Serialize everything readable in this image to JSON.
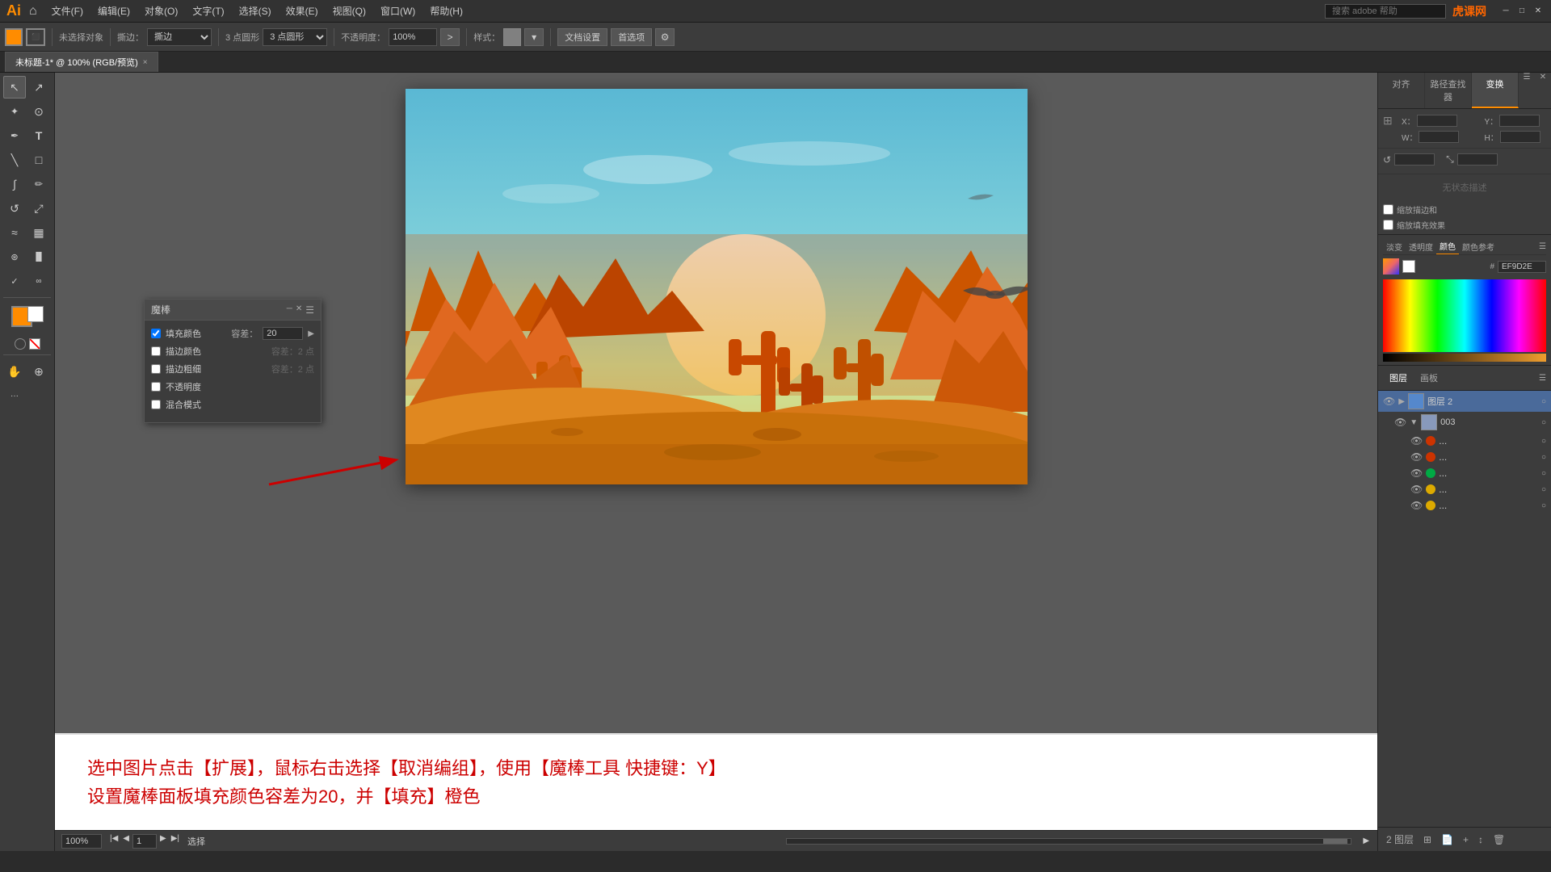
{
  "app": {
    "title": "Adobe Illustrator",
    "logo": "Ai"
  },
  "menu": {
    "items": [
      "文件(F)",
      "编辑(E)",
      "对象(O)",
      "文字(T)",
      "选择(S)",
      "效果(E)",
      "视图(Q)",
      "窗口(W)",
      "帮助(H)"
    ],
    "search_placeholder": "搜索 adobe 帮助",
    "logo_right": "虎课网",
    "window_controls": [
      "─",
      "□",
      "✕"
    ]
  },
  "toolbar": {
    "no_selection": "未选择对象",
    "stroke_label": "描边：",
    "blend_label": "撕边：",
    "blend_value": "撕边",
    "point_label": "3 点圆形",
    "opacity_label": "不透明度：",
    "opacity_value": "100%",
    "style_label": "样式：",
    "doc_settings": "文档设置",
    "prefs": "首选项"
  },
  "tab": {
    "title": "未标题-1* @ 100% (RGB/预览)",
    "close": "×"
  },
  "canvas": {
    "zoom": "100%",
    "page": "1",
    "tool_label": "选择"
  },
  "magic_wand": {
    "title": "魔棒",
    "fill_color": "填充颜色",
    "fill_color_checked": true,
    "tolerance_label": "容差：",
    "tolerance_value": "20",
    "stroke_color": "描边颜色",
    "stroke_color_checked": false,
    "stroke_width": "描边粗细",
    "stroke_width_checked": false,
    "opacity": "不透明度",
    "opacity_checked": false,
    "blend_mode": "混合模式",
    "blend_mode_checked": false,
    "stroke_tolerance": "容差：",
    "stroke_tolerance_value": "2 点",
    "stroke_width_tolerance": "容差：",
    "stroke_width_tolerance_value": "2 点"
  },
  "right_panel": {
    "tabs": [
      "对齐",
      "路径查找器",
      "变换"
    ],
    "active_tab": "变换",
    "transform": {
      "x_label": "X：",
      "y_label": "Y：",
      "w_label": "W：",
      "h_label": "H："
    },
    "no_status": "无状态描述"
  },
  "color_panel": {
    "tabs": [
      "淡变",
      "透明度",
      "颜色",
      "颜色参考"
    ],
    "hex_label": "#",
    "hex_value": "EF9D2E",
    "active_tab": "颜色"
  },
  "layers_panel": {
    "tabs": [
      "图层",
      "画板"
    ],
    "active_tab": "图层",
    "layer2": "图层 2",
    "sublayer_003": "003",
    "bottom_nav": {
      "page_info": "2 图层"
    },
    "colors": [
      "#cc3300",
      "#cc3300",
      "#00aa44",
      "#ddaa00",
      "#ddaa00"
    ]
  },
  "instructions": {
    "line1": "选中图片点击【扩展】，鼠标右击选择【取消编组】，使用【魔棒工具 快捷键：Y】",
    "line2": "设置魔棒面板填充颜色容差为20，并【填充】橙色"
  },
  "tools": [
    {
      "name": "selection",
      "icon": "↖",
      "label": "选择工具"
    },
    {
      "name": "direct-selection",
      "icon": "↗",
      "label": "直接选择"
    },
    {
      "name": "magic-wand",
      "icon": "✦",
      "label": "魔棒"
    },
    {
      "name": "lasso",
      "icon": "⊙",
      "label": "套索"
    },
    {
      "name": "pen",
      "icon": "✒",
      "label": "钢笔"
    },
    {
      "name": "type",
      "icon": "T",
      "label": "文字"
    },
    {
      "name": "line",
      "icon": "╲",
      "label": "直线"
    },
    {
      "name": "rect",
      "icon": "□",
      "label": "矩形"
    },
    {
      "name": "paintbrush",
      "icon": "∫",
      "label": "画笔"
    },
    {
      "name": "pencil",
      "icon": "✏",
      "label": "铅笔"
    },
    {
      "name": "rotate",
      "icon": "↺",
      "label": "旋转"
    },
    {
      "name": "scale",
      "icon": "⤢",
      "label": "缩放"
    },
    {
      "name": "warp",
      "icon": "≈",
      "label": "变形"
    },
    {
      "name": "graph",
      "icon": "▦",
      "label": "图表"
    },
    {
      "name": "eyedropper",
      "icon": "⌛",
      "label": "吸管"
    },
    {
      "name": "hand",
      "icon": "✋",
      "label": "抓手"
    },
    {
      "name": "zoom",
      "icon": "⊕",
      "label": "缩放"
    }
  ]
}
